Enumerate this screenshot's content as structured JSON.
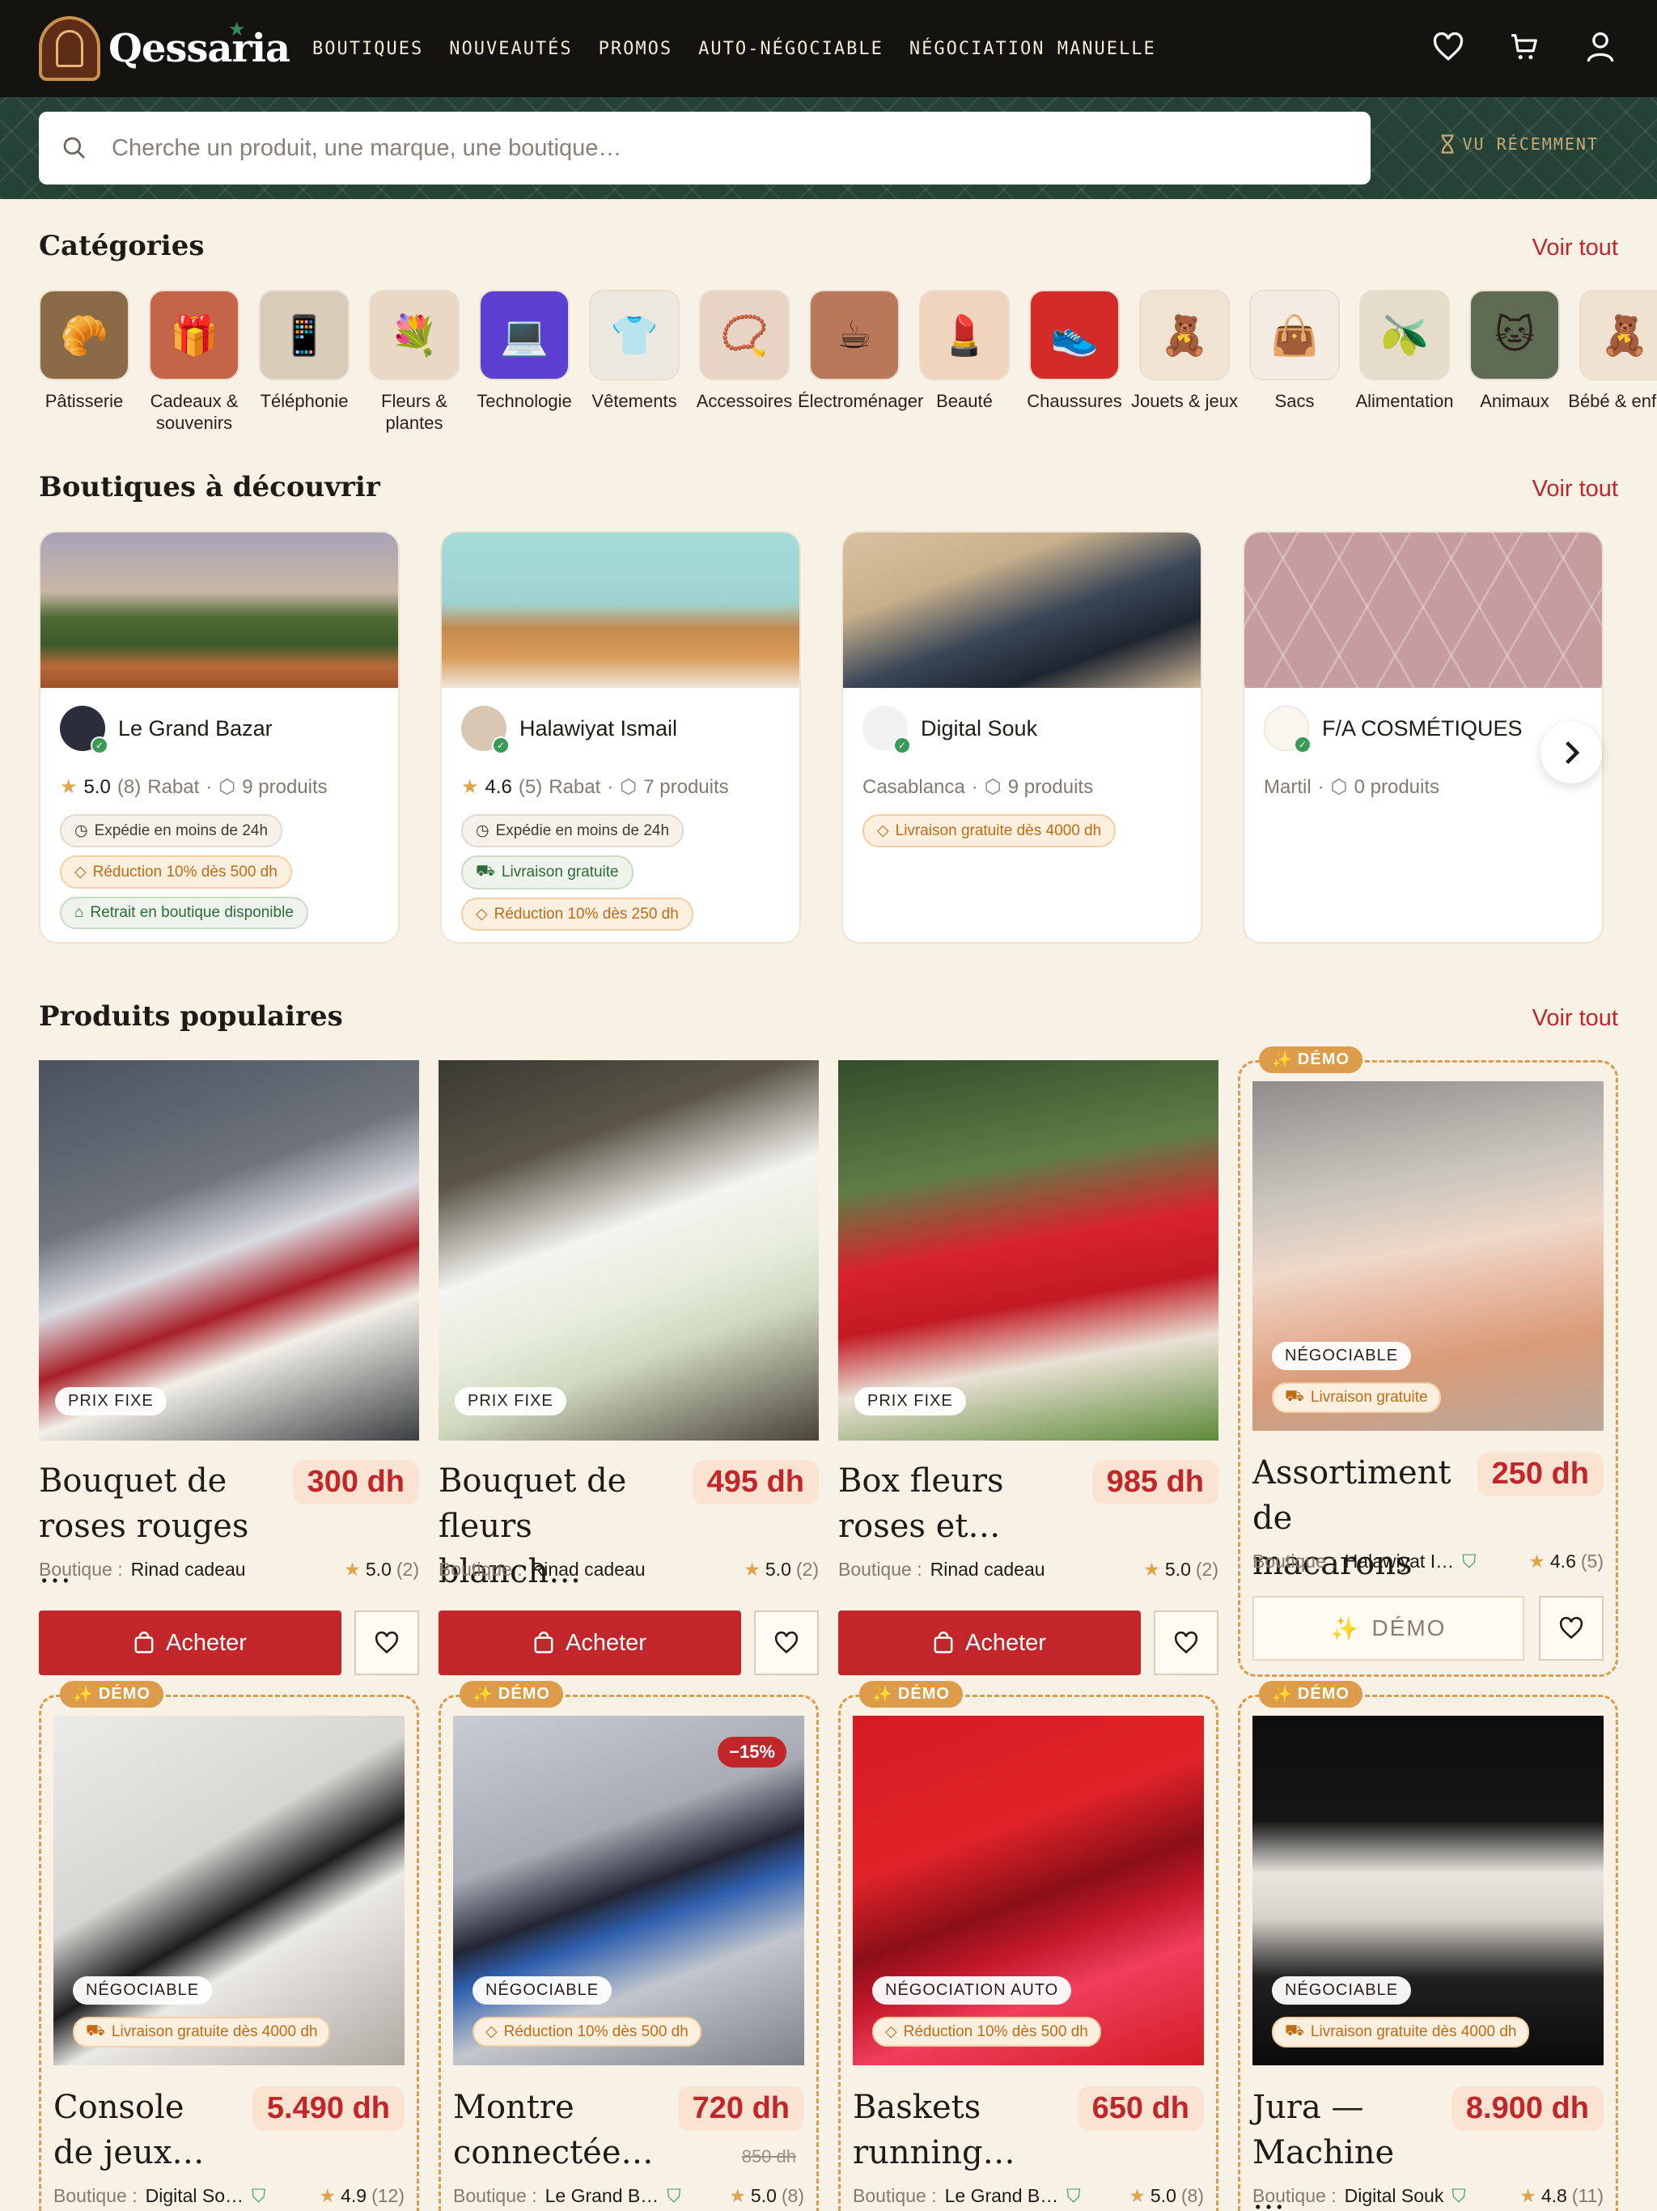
{
  "brand": {
    "name": "Qessaria"
  },
  "nav": [
    {
      "label": "BOUTIQUES"
    },
    {
      "label": "NOUVEAUTÉS"
    },
    {
      "label": "PROMOS"
    },
    {
      "label": "AUTO-NÉGOCIABLE"
    },
    {
      "label": "NÉGOCIATION MANUELLE"
    }
  ],
  "header_icons": [
    "heart-icon",
    "cart-icon",
    "user-icon"
  ],
  "search": {
    "placeholder": "Cherche un produit, une marque, une boutique…",
    "recent_label": "VU RÉCEMMENT"
  },
  "colors": {
    "primary": "#c0262a",
    "dark": "#14130f",
    "band": "#244236",
    "background": "#f8f1e6",
    "demo": "#dc9c4a"
  },
  "categories": {
    "title": "Catégories",
    "see_all": "Voir tout",
    "items": [
      {
        "label": "Pâtisserie"
      },
      {
        "label": "Cadeaux & souvenirs"
      },
      {
        "label": "Téléphonie"
      },
      {
        "label": "Fleurs & plantes"
      },
      {
        "label": "Technologie"
      },
      {
        "label": "Vêtements"
      },
      {
        "label": "Accessoires"
      },
      {
        "label": "Électroménager"
      },
      {
        "label": "Beauté"
      },
      {
        "label": "Chaussures"
      },
      {
        "label": "Jouets & jeux"
      },
      {
        "label": "Sacs"
      },
      {
        "label": "Alimentation"
      },
      {
        "label": "Animaux"
      },
      {
        "label": "Bébé & enfant"
      }
    ]
  },
  "shops": {
    "title": "Boutiques à découvrir",
    "see_all": "Voir tout",
    "items": [
      {
        "name": "Le Grand Bazar",
        "rating": "5.0",
        "reviews": "(8)",
        "city": "Rabat",
        "products": "9 produits",
        "tags": [
          {
            "text": "Expédie en moins de 24h",
            "style": "gray"
          },
          {
            "text": "Réduction 10% dès 500 dh",
            "style": "orange"
          },
          {
            "text": "Retrait en boutique disponible",
            "style": "green"
          }
        ]
      },
      {
        "name": "Halawiyat Ismail",
        "rating": "4.6",
        "reviews": "(5)",
        "city": "Rabat",
        "products": "7 produits",
        "tags": [
          {
            "text": "Expédie en moins de 24h",
            "style": "gray"
          },
          {
            "text": "Livraison gratuite",
            "style": "green"
          },
          {
            "text": "Réduction 10% dès 250 dh",
            "style": "orange"
          }
        ]
      },
      {
        "name": "Digital Souk",
        "rating": "",
        "reviews": "",
        "city": "Casablanca",
        "products": "9 produits",
        "tags": [
          {
            "text": "Livraison gratuite dès 4000 dh",
            "style": "orange"
          }
        ]
      },
      {
        "name": "F/A COSMÉTIQUES",
        "rating": "",
        "reviews": "",
        "city": "Martil",
        "products": "0 produits",
        "tags": []
      }
    ]
  },
  "products": {
    "title": "Produits populaires",
    "see_all": "Voir tout",
    "shop_prefix": "Boutique :",
    "buy_label": "Acheter",
    "demo_label": "DÉMO",
    "demo_badge": "DÉMO",
    "items": [
      {
        "title": "Bouquet de roses rouges …",
        "price": "300 dh",
        "shop": "Rinad cadeau",
        "rating": "5.0",
        "reviews": "(2)",
        "pill": "PRIX FIXE"
      },
      {
        "title": "Bouquet de fleurs blanch…",
        "price": "495 dh",
        "shop": "Rinad cadeau",
        "rating": "5.0",
        "reviews": "(2)",
        "pill": "PRIX FIXE"
      },
      {
        "title": "Box fleurs roses et…",
        "price": "985 dh",
        "shop": "Rinad cadeau",
        "rating": "5.0",
        "reviews": "(2)",
        "pill": "PRIX FIXE"
      },
      {
        "title": "Assortiment de macarons",
        "price": "250 dh",
        "shop": "Halawiyat I…",
        "rating": "4.6",
        "reviews": "(5)",
        "pill": "NÉGOCIABLE",
        "perk": "Livraison gratuite"
      },
      {
        "title": "Console de jeux…",
        "price": "5.490 dh",
        "shop": "Digital So…",
        "rating": "4.9",
        "reviews": "(12)",
        "pill": "NÉGOCIABLE",
        "perk": "Livraison gratuite dès 4000 dh"
      },
      {
        "title": "Montre connectée…",
        "price": "720 dh",
        "old_price": "850 dh",
        "discount": "−15%",
        "shop": "Le Grand B…",
        "rating": "5.0",
        "reviews": "(8)",
        "pill": "NÉGOCIABLE",
        "perk": "Réduction 10% dès 500 dh"
      },
      {
        "title": "Baskets running…",
        "price": "650 dh",
        "shop": "Le Grand B…",
        "rating": "5.0",
        "reviews": "(8)",
        "pill": "NÉGOCIATION AUTO",
        "perk": "Réduction 10% dès 500 dh"
      },
      {
        "title": "Jura — Machine …",
        "price": "8.900 dh",
        "shop": "Digital Souk",
        "rating": "4.8",
        "reviews": "(11)",
        "pill": "NÉGOCIABLE",
        "perk": "Livraison gratuite dès 4000 dh"
      }
    ]
  }
}
